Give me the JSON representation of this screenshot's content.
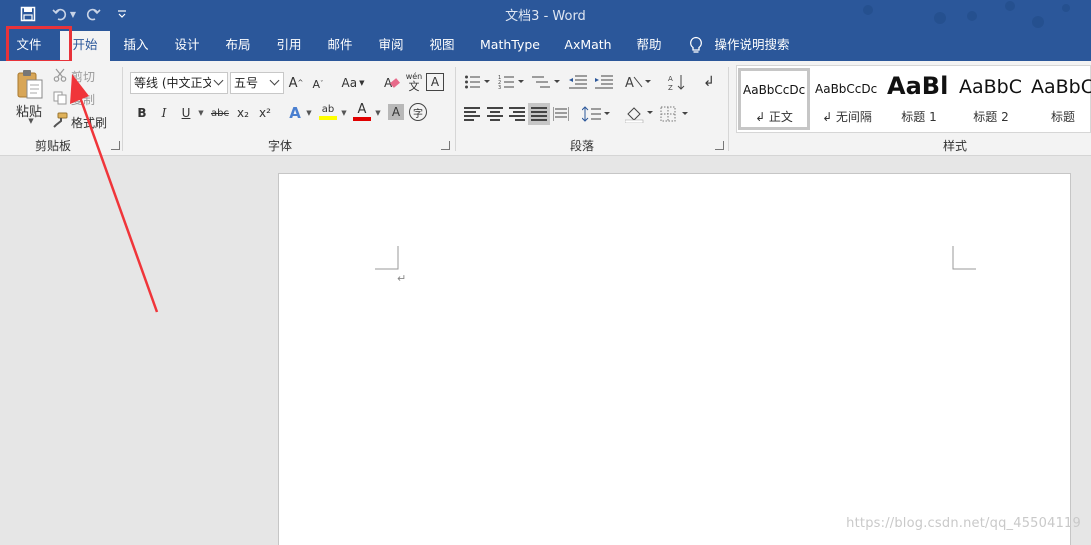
{
  "titlebar": {
    "title": "文档3  -  Word",
    "quick_access": [
      {
        "name": "save-icon",
        "glyph": "🖫"
      },
      {
        "name": "undo-icon",
        "glyph": "↶"
      },
      {
        "name": "redo-icon",
        "glyph": "↺"
      },
      {
        "name": "customize-qat-icon",
        "glyph": "▿"
      }
    ]
  },
  "tabs": [
    "文件",
    "开始",
    "插入",
    "设计",
    "布局",
    "引用",
    "邮件",
    "审阅",
    "视图",
    "MathType",
    "AxMath",
    "帮助",
    "操作说明搜索"
  ],
  "active_tab": "开始",
  "ribbon": {
    "clipboard": {
      "label": "剪贴板",
      "paste": "粘贴",
      "cut": "剪切",
      "copy": "复制",
      "format_painter": "格式刷"
    },
    "font": {
      "label": "字体",
      "font_name": "等线 (中文正文",
      "font_size": "五号",
      "grow": "A",
      "shrink": "A",
      "change_case": "Aa",
      "phonetic": "wén",
      "bold": "B",
      "italic": "I",
      "underline": "U",
      "strike": "abc",
      "subscript": "x₂",
      "superscript": "x²",
      "text_effect": "A",
      "font_color": "A",
      "char_shading": "A",
      "enclose": "字",
      "border_char": "A",
      "highlight": "ab"
    },
    "paragraph": {
      "label": "段落"
    },
    "styles": {
      "label": "样式",
      "items": [
        {
          "preview": "AaBbCcDc",
          "name": "↲ 正文"
        },
        {
          "preview": "AaBbCcDc",
          "name": "↲ 无间隔"
        },
        {
          "preview": "AaBl",
          "name": "标题 1"
        },
        {
          "preview": "AaBbC",
          "name": "标题 2"
        },
        {
          "preview": "AaBbC",
          "name": "标题"
        }
      ]
    }
  },
  "document": {
    "paragraph_mark": "↵"
  },
  "colors": {
    "brand": "#2b579a",
    "ribbon_bg": "#f3f3f3",
    "highlight_box": "#e8333a",
    "font_color_bar": "#e00000",
    "highlight_color_bar": "#ffff00"
  },
  "watermark": "https://blog.csdn.net/qq_45504119"
}
